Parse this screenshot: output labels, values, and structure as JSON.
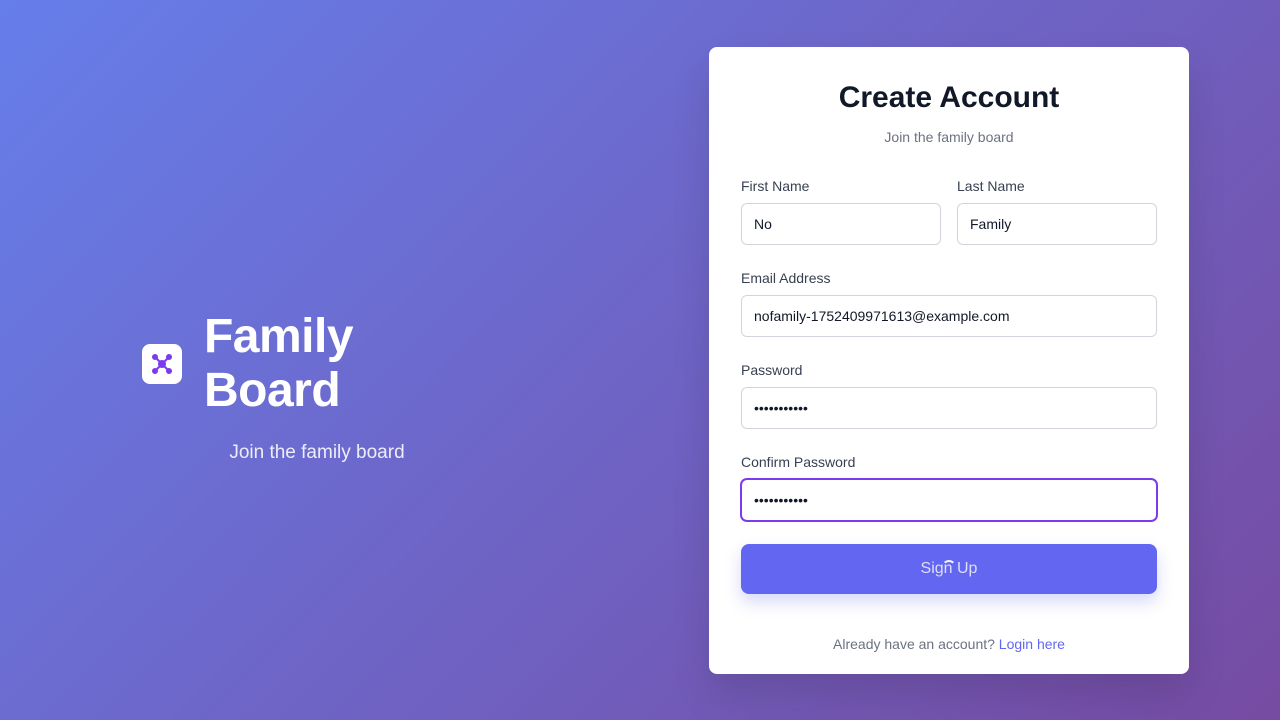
{
  "brand": {
    "title": "Family Board",
    "subtitle": "Join the family board",
    "logo_icon": "network-nodes-icon",
    "logo_color": "#7c3aed"
  },
  "card": {
    "title": "Create Account",
    "subtitle": "Join the family board"
  },
  "form": {
    "first_name": {
      "label": "First Name",
      "value": "No"
    },
    "last_name": {
      "label": "Last Name",
      "value": "Family"
    },
    "email": {
      "label": "Email Address",
      "value": "nofamily-1752409971613@example.com"
    },
    "password": {
      "label": "Password",
      "value": "•••••••••••"
    },
    "confirm_password": {
      "label": "Confirm Password",
      "value": "•••••••••••"
    },
    "submit_label": "Sign Up",
    "loading": true
  },
  "footer": {
    "prompt": "Already have an account?",
    "link_label": "Login here"
  },
  "colors": {
    "gradient_start": "#667eea",
    "gradient_end": "#764ba2",
    "accent": "#6366f1",
    "focus": "#7c3aed"
  }
}
